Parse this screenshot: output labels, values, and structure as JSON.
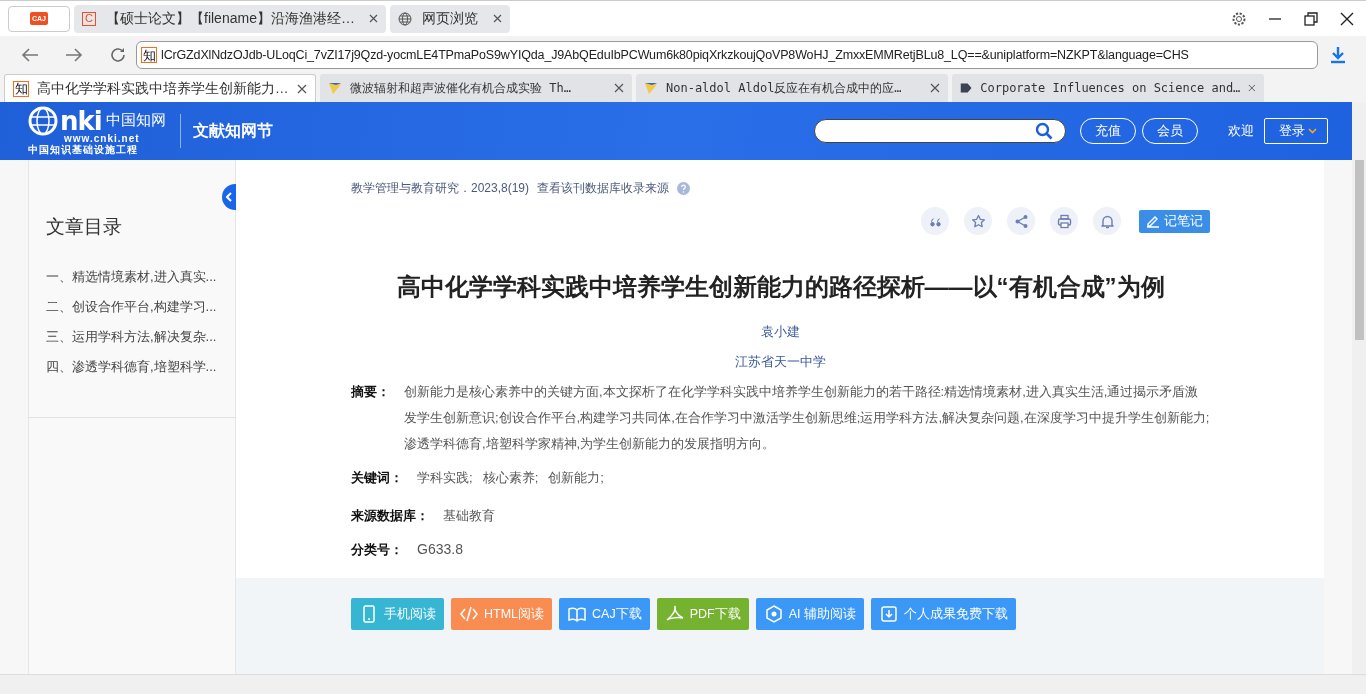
{
  "app_button": {
    "label": "CAJ"
  },
  "window_tabs": [
    {
      "label": "【硕士论文】【filename】沿海渔港经…",
      "favicon": {
        "kind": "letter",
        "text": "C"
      }
    },
    {
      "label": "网页浏览",
      "favicon": {
        "kind": "globe"
      }
    }
  ],
  "address": {
    "favicon": "知",
    "url": "lCrGZdXlNdzOJdb-ULoqCi_7vZI17j9Qzd-yocmLE4TPmaPoS9wYIQda_J9AbQEduIbPCWum6k80piqXrkzkoujQoVP8WoHJ_ZmxxEMMRetjBLu8_LQ==&uniplatform=NZKPT&language=CHS"
  },
  "doc_tabs": [
    {
      "label": "高中化学学科实践中培养学生创新能力…",
      "selected": true,
      "favicon": {
        "kind": "letter",
        "text": "知"
      }
    },
    {
      "label": "微波辐射和超声波催化有机合成实验 Th…",
      "selected": false,
      "favicon": {
        "kind": "flag"
      }
    },
    {
      "label": "Non-aldol Aldol反应在有机合成中的应…",
      "selected": false,
      "favicon": {
        "kind": "flag"
      }
    },
    {
      "label": "Corporate Influences on Science and…",
      "selected": false,
      "favicon": {
        "kind": "tag"
      }
    }
  ],
  "header": {
    "logo": {
      "mark": "nki",
      "name": "中国知网",
      "url": "www.cnki.net",
      "tagline": "中国知识基础设施工程"
    },
    "section": "文献知网节",
    "buttons": [
      "充值",
      "会员"
    ],
    "welcome": "欢迎",
    "login": "登录"
  },
  "sidebar": {
    "title": "文章目录",
    "items": [
      "一、精选情境素材,进入真实...",
      "二、创设合作平台,构建学习...",
      "三、运用学科方法,解决复杂...",
      "四、渗透学科德育,培塑科学..."
    ]
  },
  "article": {
    "journal": "教学管理与教育研究．2023,8(19)",
    "source_link": "查看该刊数据库收录来源",
    "actions": [
      {
        "kind": "cite"
      },
      {
        "kind": "favorite"
      },
      {
        "kind": "share"
      },
      {
        "kind": "print"
      },
      {
        "kind": "alert"
      }
    ],
    "note_button": "记笔记",
    "title": "高中化学学科实践中培养学生创新能力的路径探析——以“有机合成”为例",
    "author": "袁小建",
    "affiliation": "江苏省天一中学",
    "abstract": {
      "label": "摘要：",
      "text": "创新能力是核心素养中的关键方面,本文探析了在化学学科实践中培养学生创新能力的若干路径:精选情境素材,进入真实生活,通过揭示矛盾激发学生创新意识;创设合作平台,构建学习共同体,在合作学习中激活学生创新思维;运用学科方法,解决复杂问题,在深度学习中提升学生创新能力;渗透学科德育,培塑科学家精神,为学生创新能力的发展指明方向。"
    },
    "keywords": {
      "label": "关键词：",
      "items": [
        "学科实践;",
        "核心素养;",
        "创新能力;"
      ]
    },
    "database": {
      "label": "来源数据库：",
      "value": "基础教育"
    },
    "classification": {
      "label": "分类号：",
      "value": "G633.8"
    }
  },
  "downloads": [
    {
      "label": "手机阅读",
      "kind": "phone",
      "color": "#36b6d3"
    },
    {
      "label": "HTML阅读",
      "kind": "code",
      "color": "#f98c51"
    },
    {
      "label": "CAJ下载",
      "kind": "book",
      "color": "#3b98f6"
    },
    {
      "label": "PDF下载",
      "kind": "pdf",
      "color": "#75b22f"
    },
    {
      "label": "AI 辅助阅读",
      "kind": "ai",
      "color": "#3b98f6"
    },
    {
      "label": "个人成果免费下载",
      "kind": "download",
      "color": "#3b98f6"
    }
  ]
}
